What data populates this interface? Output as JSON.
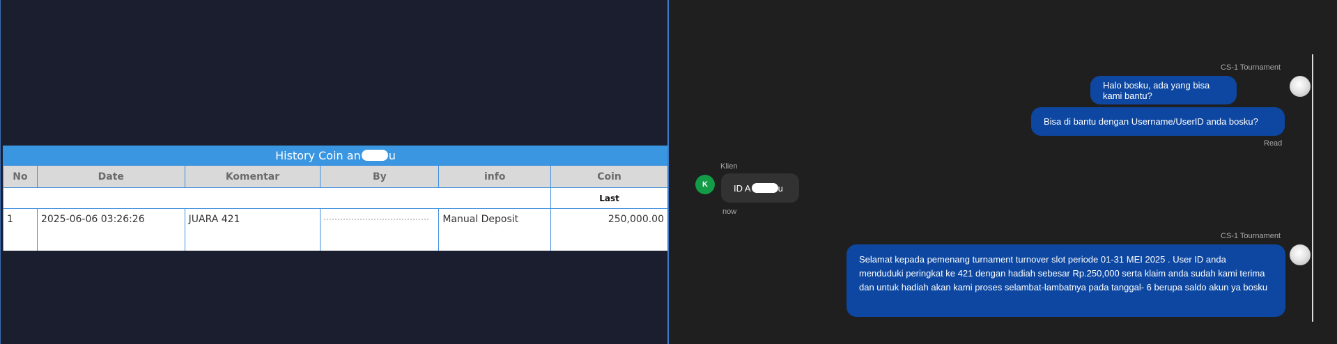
{
  "history": {
    "title_prefix": "History Coin an",
    "title_suffix": "u",
    "columns": [
      "No",
      "Date",
      "Komentar",
      "By",
      "info",
      "Coin"
    ],
    "subheader_last": "Last",
    "rows": [
      {
        "no": "1",
        "date": "2025-06-06 03:26:26",
        "komentar": "JUARA 421",
        "by": "",
        "info": "Manual Deposit",
        "coin": "250,000.00"
      }
    ]
  },
  "chat": {
    "agent_name": "CS-1 Tournament",
    "messages_top": [
      "Halo bosku, ada yang bisa kami bantu?",
      "Bisa di bantu dengan Username/UserID anda bosku?"
    ],
    "read_status": "Read",
    "client_name": "Klien",
    "client_initial": "K",
    "client_message_prefix": "ID A",
    "client_message_suffix": "u",
    "client_time": "now",
    "agent_name_2": "CS-1 Tournament",
    "final_message": "Selamat kepada pemenang turnament turnover slot periode 01-31 MEI 2025 . User ID anda menduduki peringkat ke 421 dengan hadiah sebesar Rp.250,000 serta klaim anda sudah kami terima dan untuk hadiah akan kami proses selambat-lambatnya pada tanggal- 6 berupa saldo akun ya bosku"
  },
  "colors": {
    "table_header_bar": "#3a96e0",
    "outgoing_bubble": "#0d47a1",
    "incoming_bubble": "#323232",
    "client_avatar": "#139b47",
    "coin_value": "#2e8b2e"
  }
}
